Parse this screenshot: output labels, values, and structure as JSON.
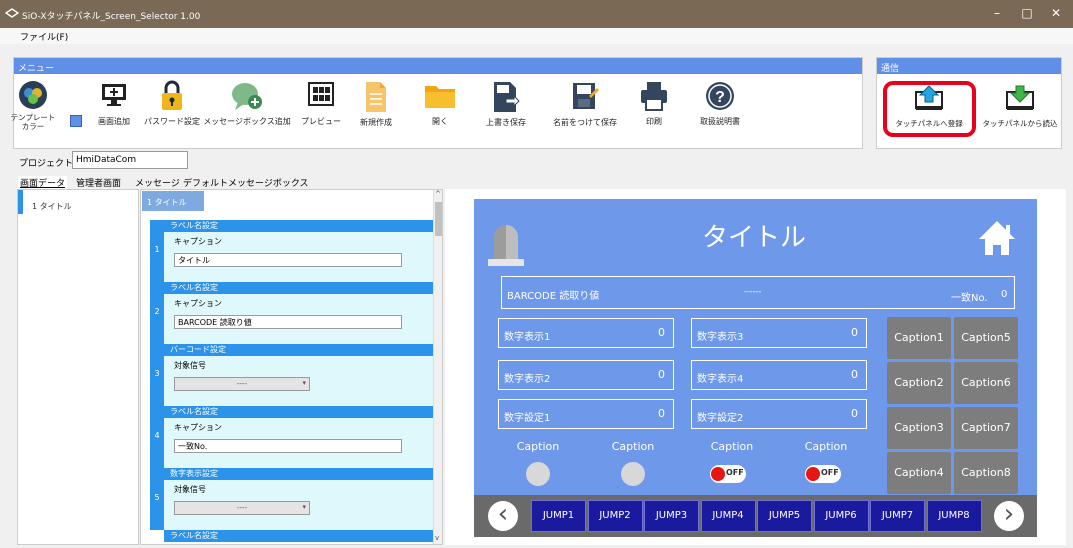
{
  "window": {
    "title": "SiO-Xタッチパネル_Screen_Selector 1.00",
    "minimize": "–",
    "maximize": "□",
    "close": "✕"
  },
  "menubar": {
    "file": "ファイル(F)"
  },
  "menu_group": {
    "header": "メニュー",
    "items": [
      {
        "label": "テンプレート\nカラー",
        "icon": "template-color-icon"
      },
      {
        "label": "画面追加",
        "icon": "monitor-add-icon"
      },
      {
        "label": "パスワード設定",
        "icon": "lock-icon"
      },
      {
        "label": "メッセージボックス追加",
        "icon": "message-add-icon"
      },
      {
        "label": "プレビュー",
        "icon": "preview-grid-icon"
      },
      {
        "label": "新規作成",
        "icon": "new-file-icon"
      },
      {
        "label": "開く",
        "icon": "folder-open-icon"
      },
      {
        "label": "上書き保存",
        "icon": "save-overwrite-icon"
      },
      {
        "label": "名前をつけて保存",
        "icon": "save-as-icon"
      },
      {
        "label": "印刷",
        "icon": "print-icon"
      },
      {
        "label": "取扱説明書",
        "icon": "help-icon"
      }
    ]
  },
  "comm_group": {
    "header": "通信",
    "items": [
      {
        "label": "タッチパネルへ登録",
        "icon": "upload-to-panel-icon"
      },
      {
        "label": "タッチパネルから読込",
        "icon": "download-from-panel-icon"
      }
    ]
  },
  "project": {
    "label": "プロジェクト名",
    "value": "HmiDataCom"
  },
  "tabs": [
    "画面データ",
    "管理者画面",
    "メッセージ",
    "デフォルトメッセージボックス"
  ],
  "screen_list": [
    {
      "label": "1 タイトル"
    }
  ],
  "editor": {
    "header": "1 タイトル",
    "rows": [
      {
        "num": "1",
        "section": "ラベル名設定",
        "field": "キャプション",
        "value": "タイトル",
        "type": "text"
      },
      {
        "num": "2",
        "section": "ラベル名設定",
        "field": "キャプション",
        "value": "BARCODE 読取り値",
        "type": "text"
      },
      {
        "num": "3",
        "section": "バーコード設定",
        "field": "対象信号",
        "value": "----",
        "type": "select"
      },
      {
        "num": "4",
        "section": "ラベル名設定",
        "field": "キャプション",
        "value": "一致No.",
        "type": "text"
      },
      {
        "num": "5",
        "section": "数字表示設定",
        "field": "対象信号",
        "value": "----",
        "type": "select"
      }
    ],
    "next_section": "ラベル名設定"
  },
  "preview": {
    "title": "タイトル",
    "barcode_label": "BARCODE 読取り値",
    "barcode_value": "------",
    "match_label": "一致No.",
    "match_value": "0",
    "numbers": [
      {
        "label": "数字表示1",
        "value": "0"
      },
      {
        "label": "数字表示3",
        "value": "0"
      },
      {
        "label": "数字表示2",
        "value": "0"
      },
      {
        "label": "数字表示4",
        "value": "0"
      },
      {
        "label": "数字設定1",
        "value": "0"
      },
      {
        "label": "数字設定2",
        "value": "0"
      }
    ],
    "captions": [
      "Caption",
      "Caption",
      "Caption",
      "Caption"
    ],
    "off_label": "OFF",
    "cap_buttons": [
      "Caption1",
      "Caption5",
      "Caption2",
      "Caption6",
      "Caption3",
      "Caption7",
      "Caption4",
      "Caption8"
    ],
    "jumps": [
      "JUMP1",
      "JUMP2",
      "JUMP3",
      "JUMP4",
      "JUMP5",
      "JUMP6",
      "JUMP7",
      "JUMP8"
    ],
    "prev": "‹",
    "next": "›"
  },
  "colors": {
    "accent": "#5f8fe6",
    "preview_bg": "#6e98ea",
    "highlight": "#e8001c",
    "row_header": "#2b93e9"
  }
}
